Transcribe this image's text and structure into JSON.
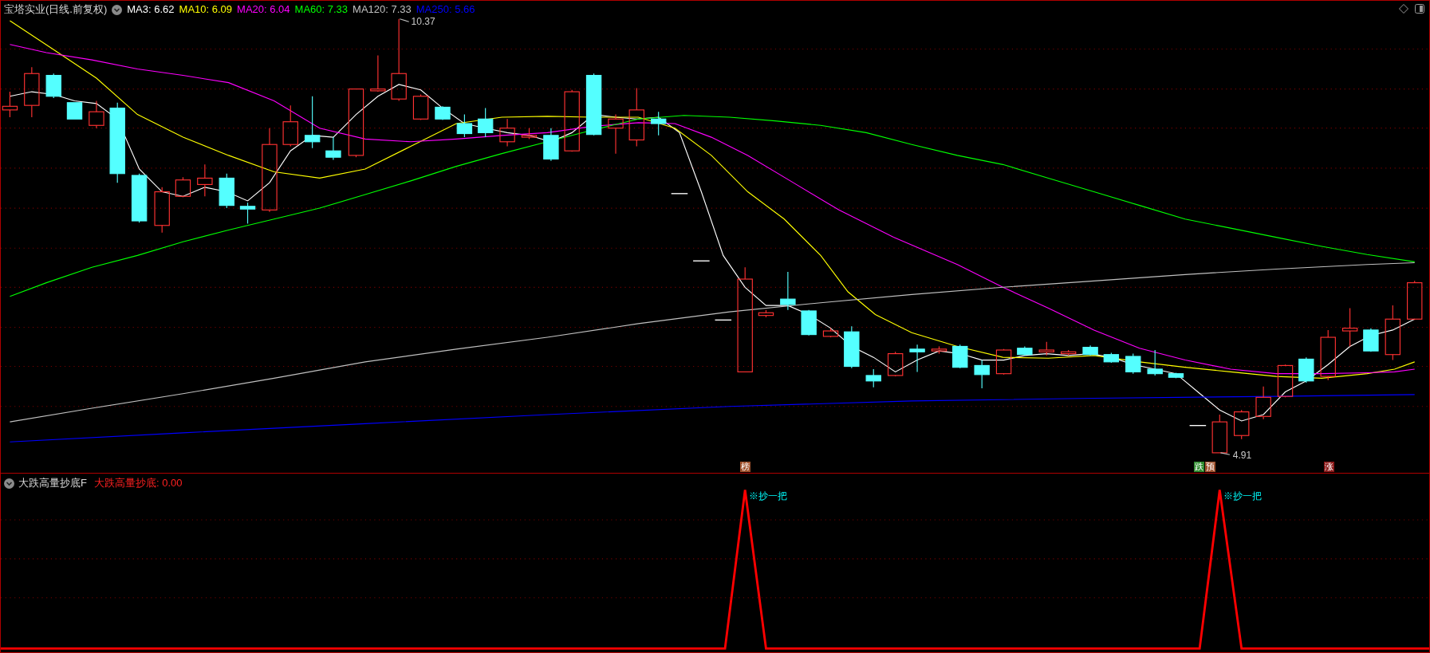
{
  "main_chart": {
    "title": "宝塔实业(日线.前复权)",
    "moving_averages": [
      {
        "label": "MA3: 6.62",
        "color": "#ffffff"
      },
      {
        "label": "MA10: 6.09",
        "color": "#ffff00"
      },
      {
        "label": "MA20: 6.04",
        "color": "#ff00ff"
      },
      {
        "label": "MA60: 7.33",
        "color": "#00ff00"
      },
      {
        "label": "MA120: 7.33",
        "color": "#c0c0c0"
      },
      {
        "label": "MA250: 5.66",
        "color": "#0000ff"
      }
    ],
    "high_label": "10.37",
    "low_label": "4.91",
    "markers": [
      {
        "text": "榜",
        "color": "#a0522d"
      },
      {
        "text": "跌",
        "color": "#2e8b2e"
      },
      {
        "text": "预",
        "color": "#a0522d"
      },
      {
        "text": "涨",
        "color": "#8b1a1a"
      }
    ]
  },
  "indicator_panel": {
    "title": "大跌高量抄底F",
    "reading": "大跌高量抄底: 0.00",
    "signals": [
      "※抄一把",
      "※抄一把"
    ]
  }
}
